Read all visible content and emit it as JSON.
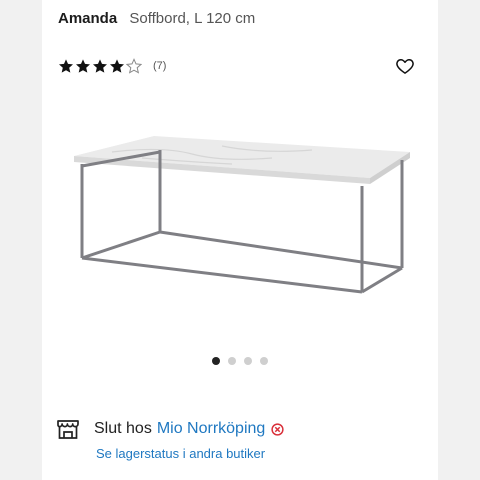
{
  "product": {
    "brand": "Amanda",
    "subtitle": "Soffbord, L 120 cm"
  },
  "rating": {
    "stars_filled": 4,
    "stars_total": 5,
    "count_label": "(7)"
  },
  "wishlist": {
    "icon": "heart-outline-icon"
  },
  "gallery": {
    "image": "marble-coffee-table",
    "total_images": 4,
    "active_index": 0
  },
  "stock": {
    "status_prefix": "Slut hos",
    "store_name": "Mio Norrköping",
    "status_icon": "out-of-stock-icon",
    "status_color": "#d9303a",
    "other_stores_link": "Se lagerstatus i andra butiker"
  },
  "colors": {
    "link": "#1f78c1",
    "background": "#f1f1f1",
    "dot_active": "#222222",
    "dot_inactive": "#cfcfcf"
  }
}
